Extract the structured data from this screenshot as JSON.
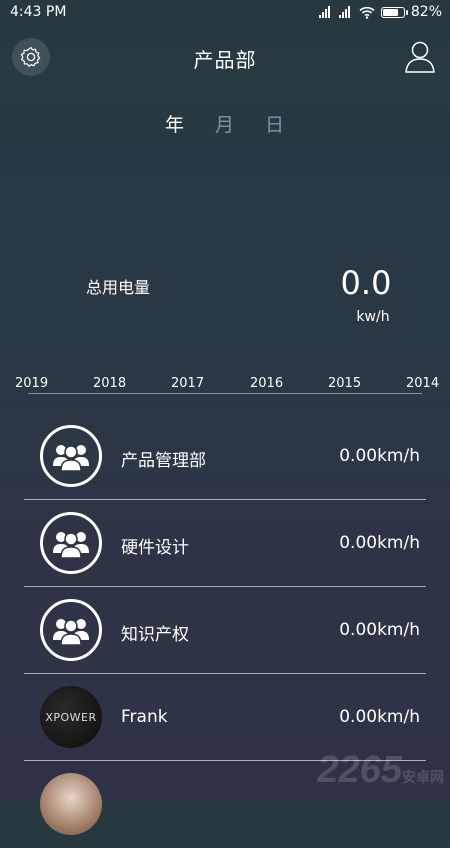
{
  "status_bar": {
    "time": "4:43 PM",
    "battery": "82%",
    "battery_level": 0.82
  },
  "header": {
    "title": "产品部"
  },
  "tabs": [
    {
      "label": "年",
      "active": true
    },
    {
      "label": "月",
      "active": false
    },
    {
      "label": "日",
      "active": false
    }
  ],
  "usage": {
    "label": "总用电量",
    "value": "0.0",
    "unit": "kw/h"
  },
  "years": [
    "2019",
    "2018",
    "2017",
    "2016",
    "2015",
    "2014"
  ],
  "list": [
    {
      "name": "产品管理部",
      "value": "0.00km/h",
      "avatar": "group-icon"
    },
    {
      "name": "硬件设计",
      "value": "0.00km/h",
      "avatar": "group-icon"
    },
    {
      "name": "知识产权",
      "value": "0.00km/h",
      "avatar": "group-icon"
    },
    {
      "name": "Frank",
      "value": "0.00km/h",
      "avatar": "XPOWER"
    },
    {
      "name": "",
      "value": "",
      "avatar": "photo"
    }
  ],
  "watermark": {
    "text": "2265",
    "suffix": "安卓网"
  }
}
